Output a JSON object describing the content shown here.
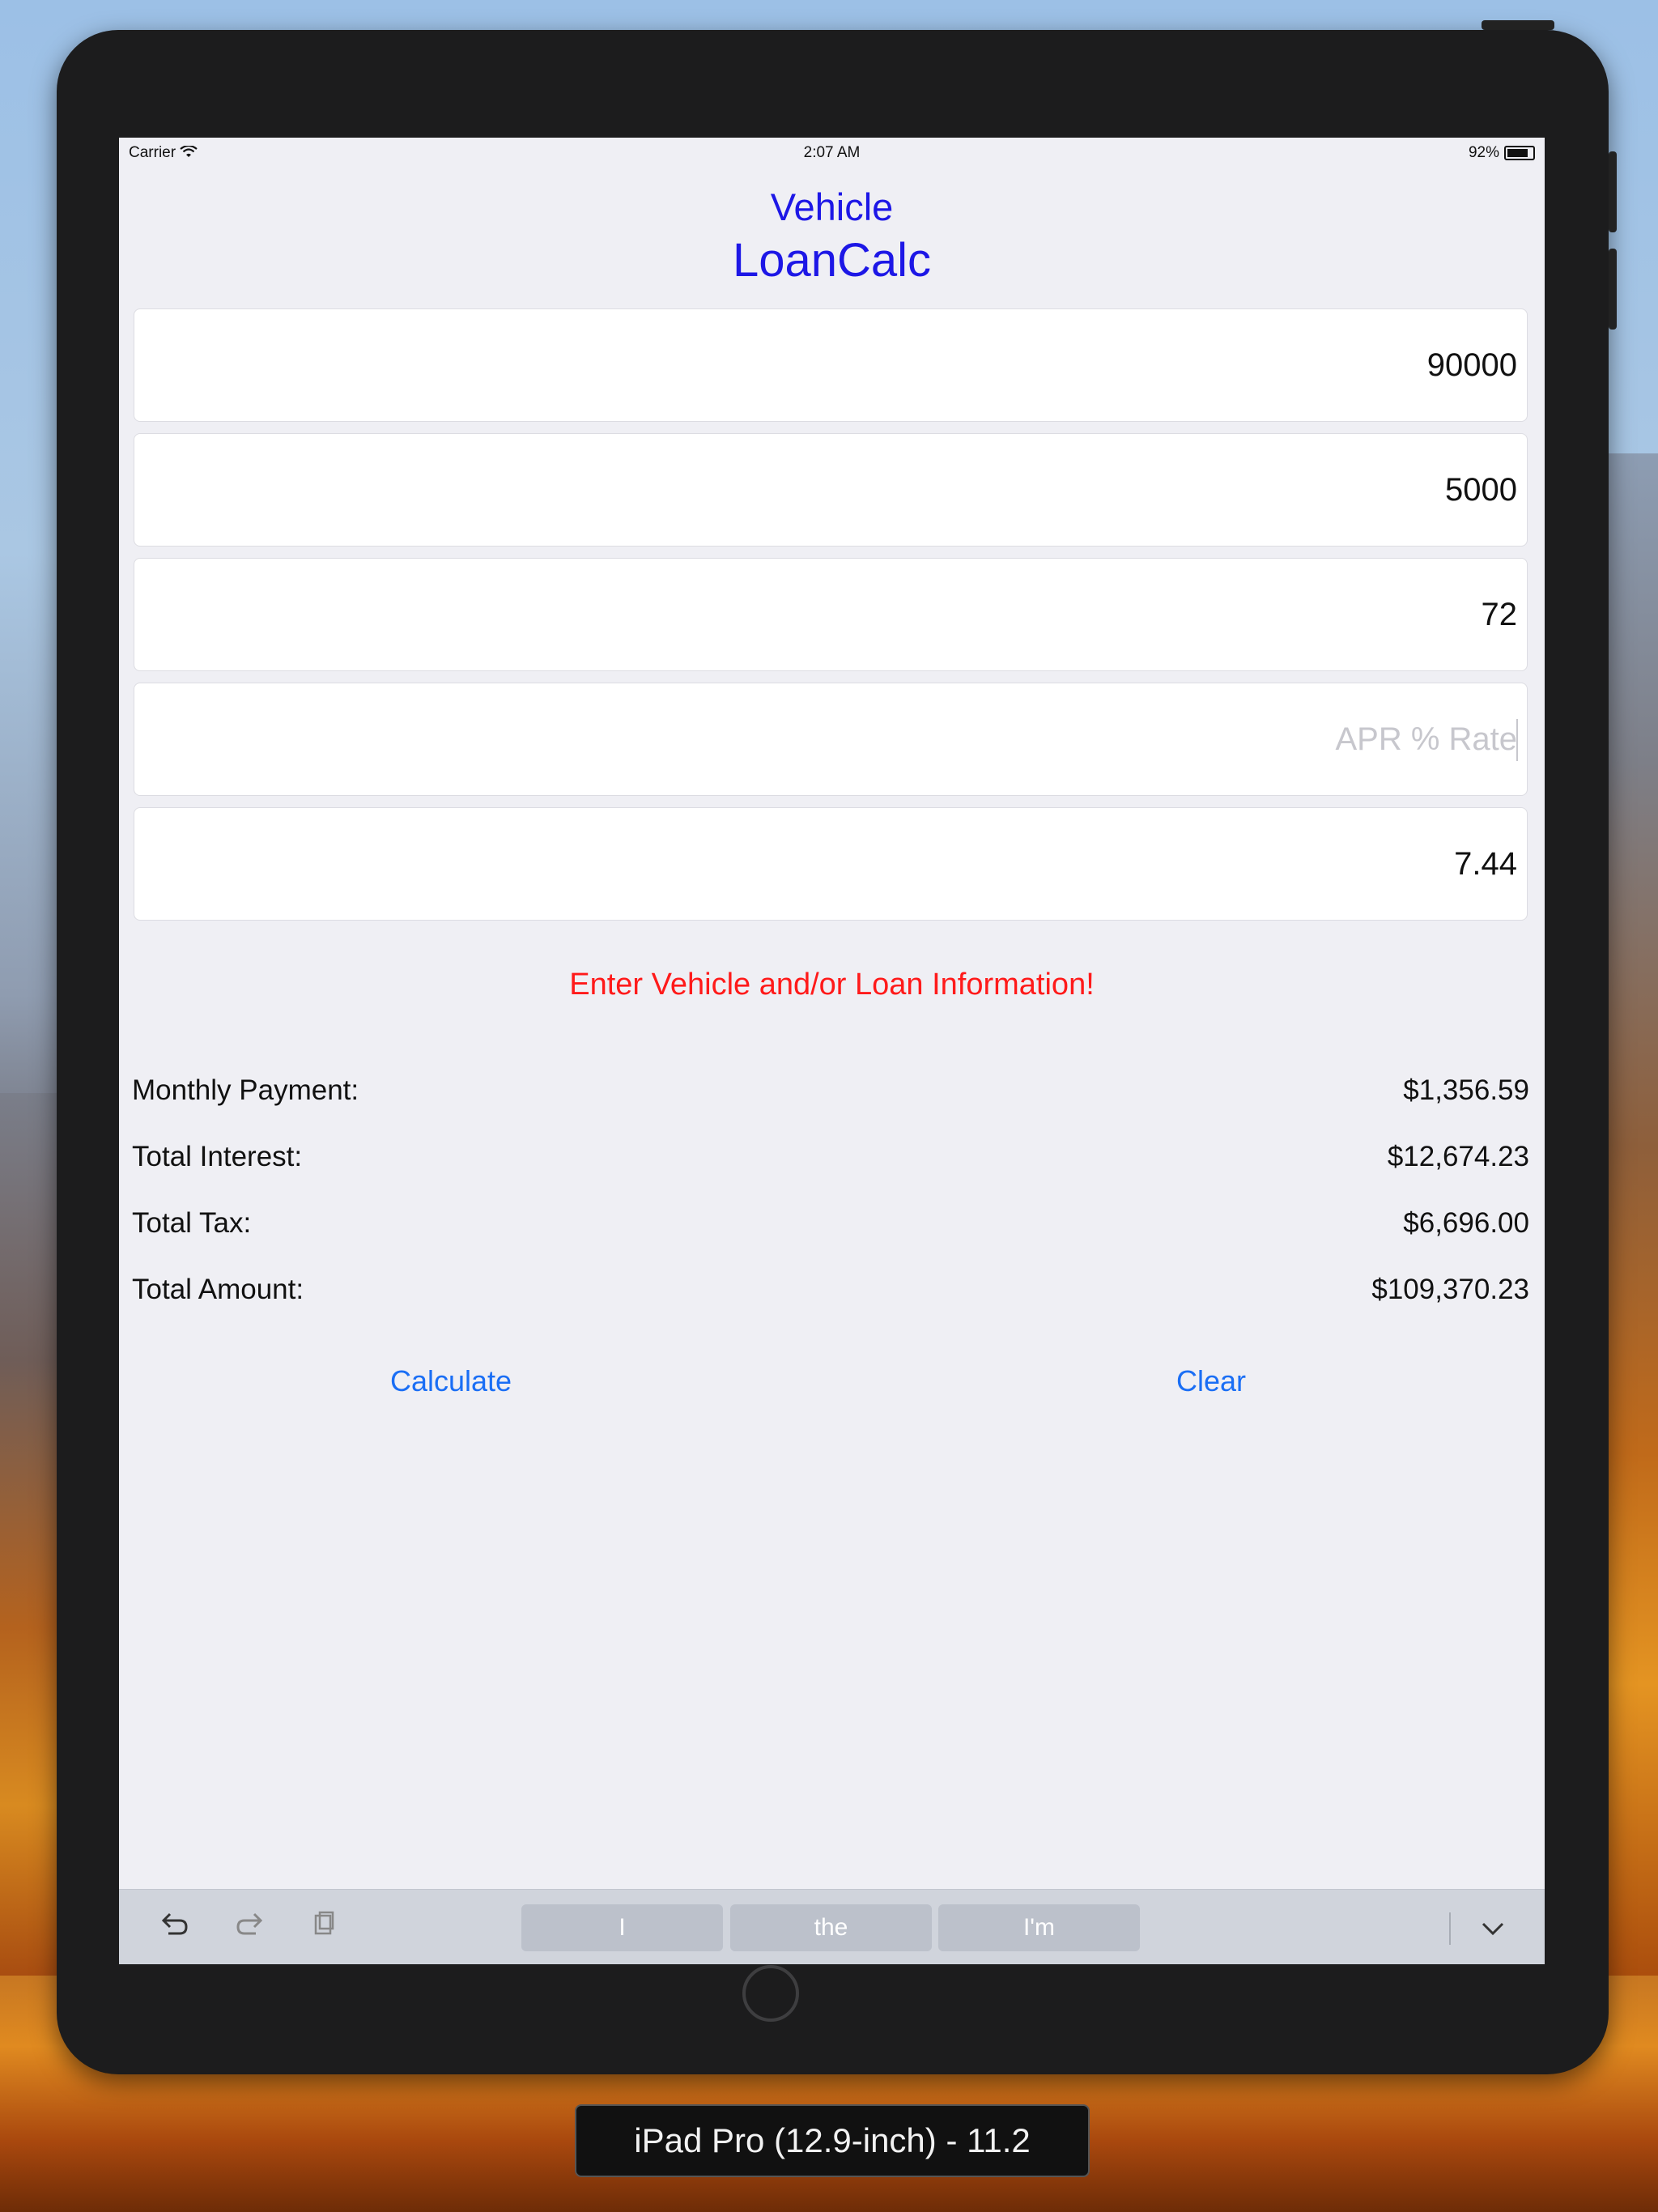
{
  "simulator": {
    "device_label": "iPad Pro (12.9-inch) - 11.2"
  },
  "status_bar": {
    "carrier": "Carrier",
    "time": "2:07 AM",
    "battery": "92%"
  },
  "app": {
    "title_line1": "Vehicle",
    "title_line2": "LoanCalc",
    "fields": [
      {
        "value": "90000",
        "placeholder": ""
      },
      {
        "value": "5000",
        "placeholder": ""
      },
      {
        "value": "72",
        "placeholder": ""
      },
      {
        "value": "",
        "placeholder": "APR % Rate"
      },
      {
        "value": "7.44",
        "placeholder": ""
      }
    ],
    "message": "Enter Vehicle and/or Loan Information!",
    "results": [
      {
        "label": "Monthly Payment:",
        "value": "$1,356.59"
      },
      {
        "label": "Total Interest:",
        "value": "$12,674.23"
      },
      {
        "label": "Total Tax:",
        "value": "$6,696.00"
      },
      {
        "label": "Total Amount:",
        "value": "$109,370.23"
      }
    ],
    "buttons": {
      "calculate": "Calculate",
      "clear": "Clear"
    }
  },
  "keyboard_bar": {
    "suggestions": [
      "I",
      "the",
      "I'm"
    ],
    "icons": [
      "undo-icon",
      "redo-icon",
      "paste-icon",
      "dismiss-keyboard-icon"
    ]
  },
  "colors": {
    "title_blue": "#1d17e6",
    "link_blue": "#1a6ef5",
    "message_red": "#ff1a1a",
    "screen_bg": "#efeff4"
  }
}
